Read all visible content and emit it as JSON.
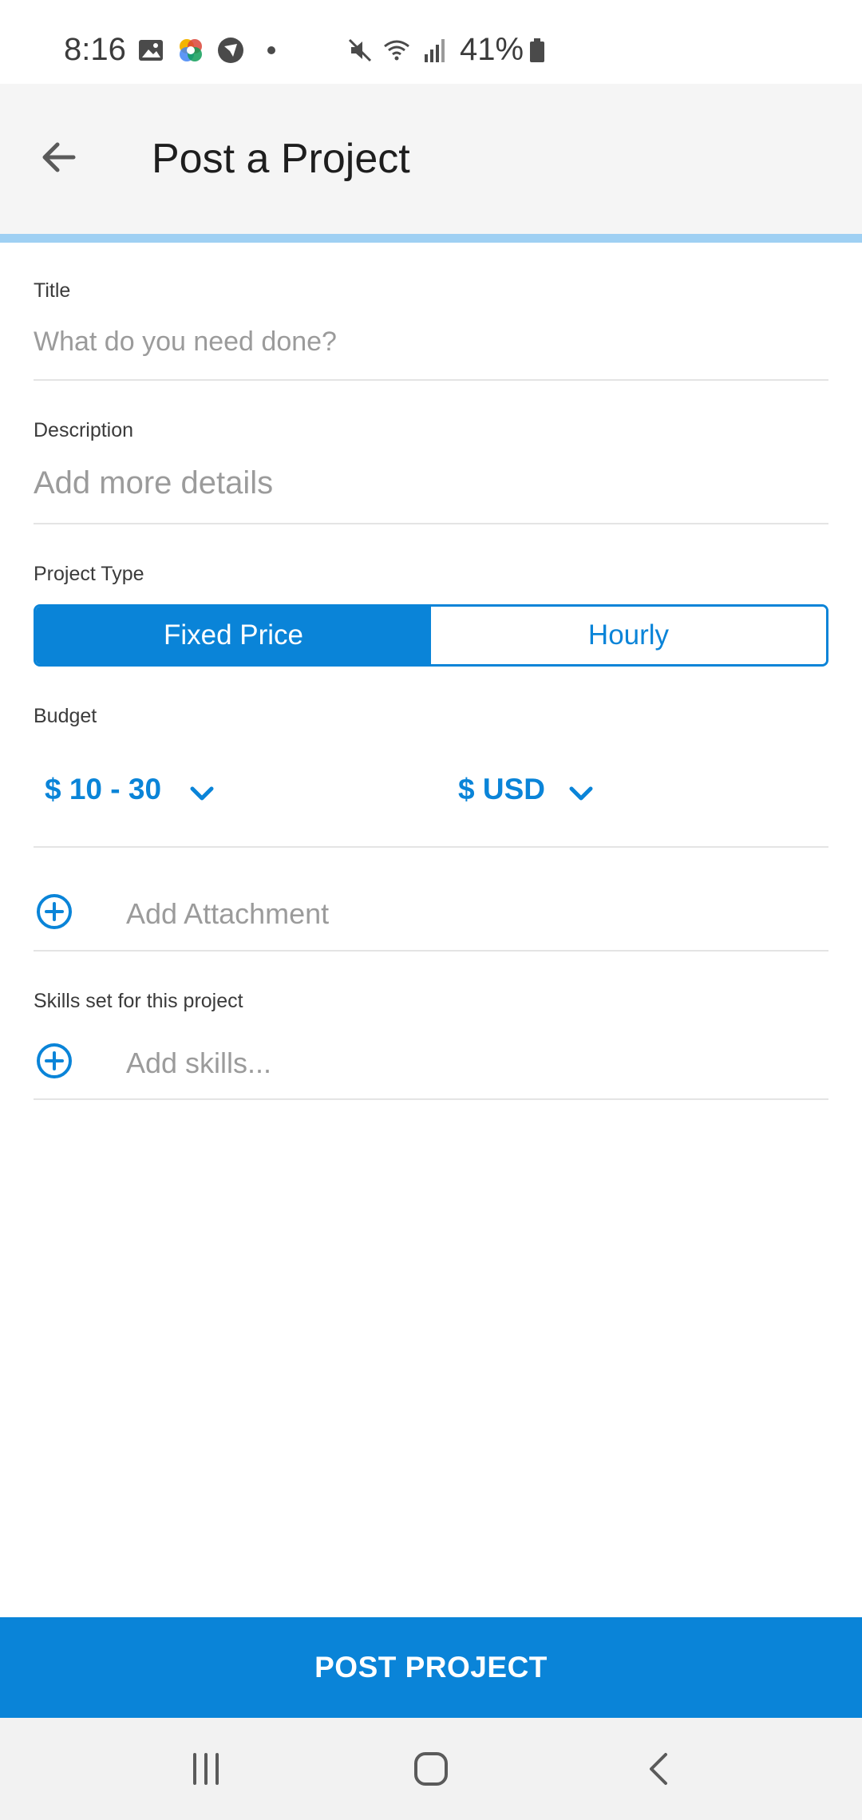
{
  "status_bar": {
    "time": "8:16",
    "battery": "41%",
    "icons": [
      "gallery-icon",
      "color-app-icon",
      "vpn-app-icon",
      "dot-icon",
      "mute-icon",
      "wifi-icon",
      "signal-icon",
      "battery-icon"
    ]
  },
  "app_bar": {
    "title": "Post a Project",
    "back_icon": "arrow-left-icon"
  },
  "form": {
    "title_label": "Title",
    "title_placeholder": "What do you need done?",
    "description_label": "Description",
    "description_placeholder": "Add more details",
    "project_type_label": "Project Type",
    "project_type_options": [
      "Fixed Price",
      "Hourly"
    ],
    "project_type_selected": "Fixed Price",
    "budget_label": "Budget",
    "budget_range": "$ 10 - 30",
    "currency": "$ USD",
    "attachment_label": "Add Attachment",
    "skills_label": "Skills set for this project",
    "skills_placeholder": "Add skills..."
  },
  "submit_label": "POST PROJECT",
  "nav_bar": {
    "icons": [
      "recents-icon",
      "home-icon",
      "back-icon"
    ]
  },
  "colors": {
    "accent": "#0a84d8",
    "progress": "#9fd0f3",
    "appbar_bg": "#f5f5f5"
  }
}
